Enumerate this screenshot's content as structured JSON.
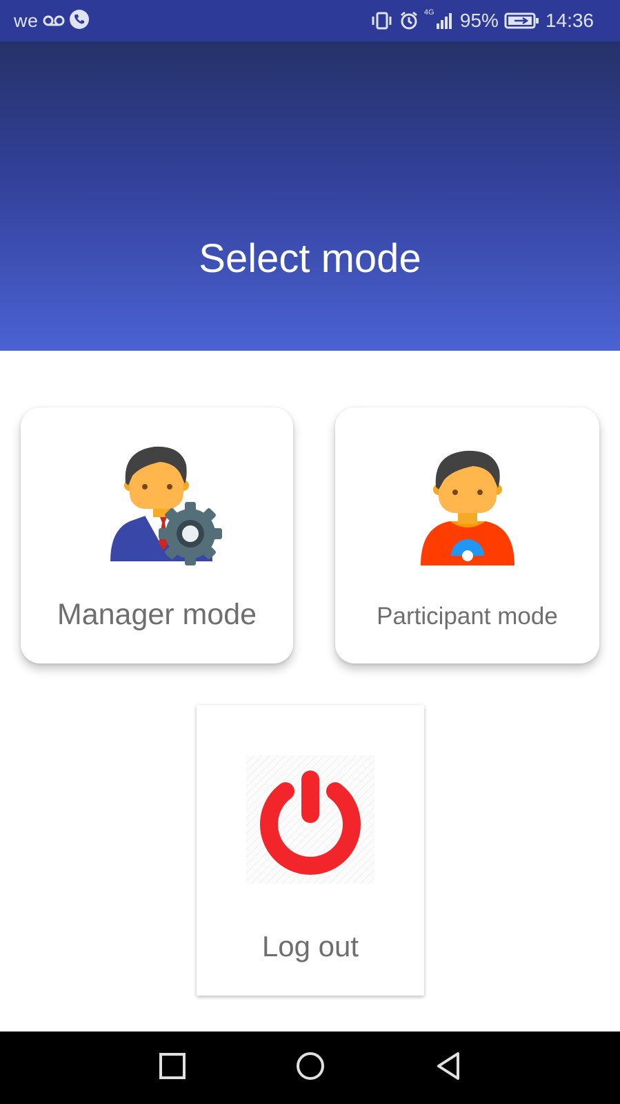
{
  "status_bar": {
    "carrier": "we",
    "battery": "95%",
    "time": "14:36",
    "network": "4G",
    "icons": [
      "voicemail-icon",
      "phone-icon",
      "vibrate-icon",
      "alarm-icon",
      "signal-icon",
      "battery-charging-icon"
    ]
  },
  "header": {
    "title": "Select mode",
    "gradient": [
      "#253269",
      "#4a62d3"
    ]
  },
  "modes": {
    "manager": {
      "label": "Manager mode",
      "icon": "manager-gear-icon"
    },
    "participant": {
      "label": "Participant mode",
      "icon": "participant-icon"
    }
  },
  "logout": {
    "label": "Log out",
    "icon": "power-icon",
    "color": "#f2252b"
  },
  "nav": {
    "recent": "recent-apps-icon",
    "home": "home-icon",
    "back": "back-icon"
  }
}
